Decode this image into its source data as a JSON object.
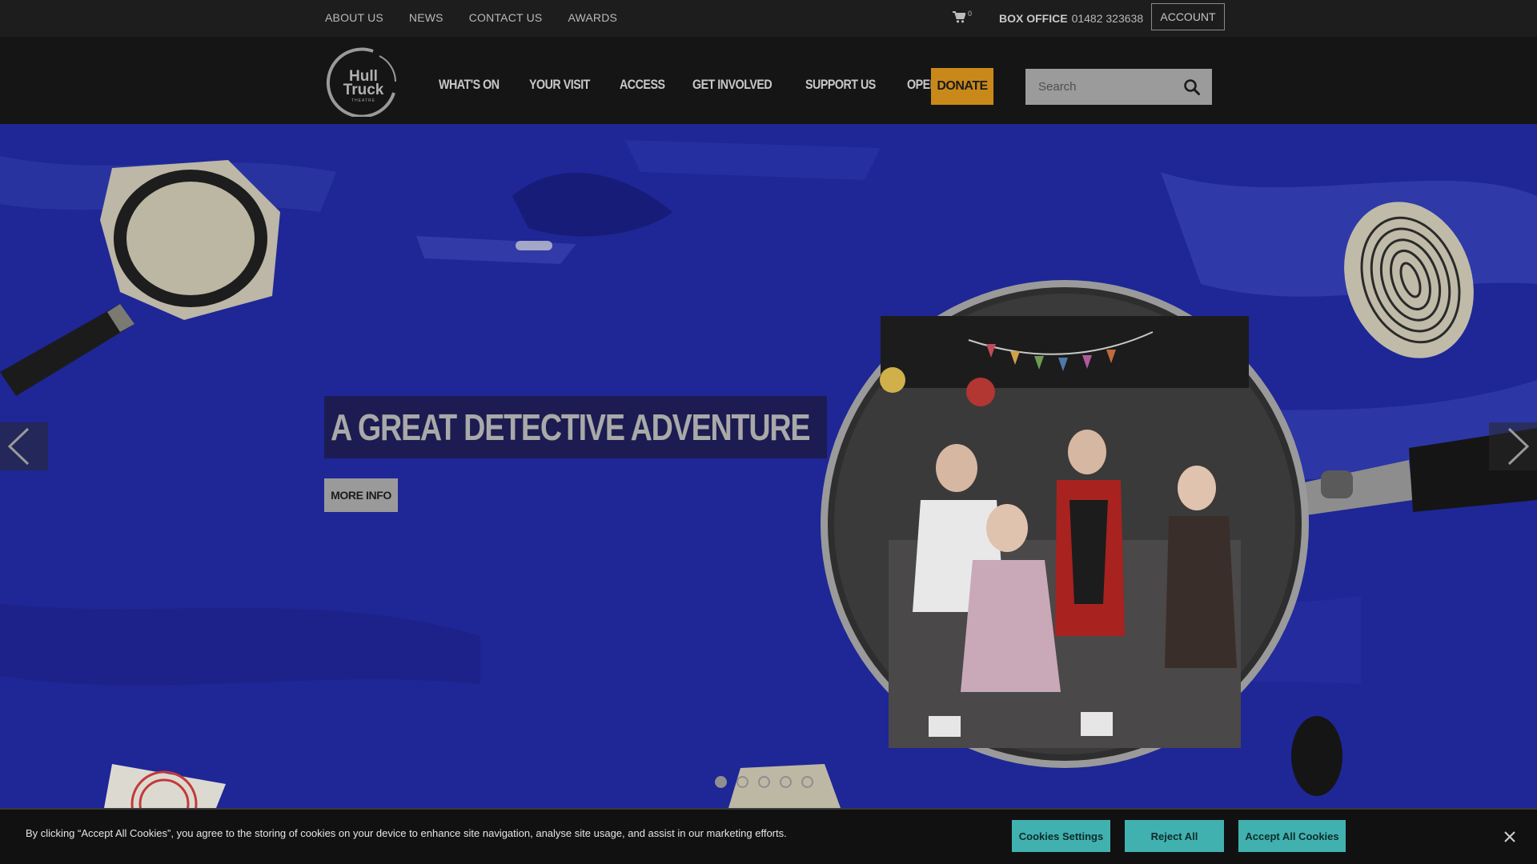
{
  "utility_nav": {
    "items": [
      {
        "label": "ABOUT US"
      },
      {
        "label": "NEWS"
      },
      {
        "label": "CONTACT US"
      },
      {
        "label": "AWARDS"
      }
    ],
    "cart": {
      "icon": "cart-icon",
      "count": "0"
    },
    "box_office": {
      "label": "BOX OFFICE",
      "phone": "01482 323638"
    },
    "account_label": "ACCOUNT"
  },
  "header": {
    "logo_text": {
      "line1": "Hull",
      "line2": "Truck",
      "line3": "THEATRE"
    },
    "nav": [
      {
        "label": "WHAT'S ON"
      },
      {
        "label": "YOUR VISIT"
      },
      {
        "label": "ACCESS"
      },
      {
        "label": "GET INVOLVED"
      },
      {
        "label": "SUPPORT US"
      },
      {
        "label": "OPEN DAY"
      }
    ],
    "donate_label": "DONATE",
    "search": {
      "placeholder": "Search",
      "icon": "search-icon"
    }
  },
  "hero": {
    "title": "A GREAT DETECTIVE ADVENTURE",
    "cta_label": "MORE INFO",
    "slides_total": 5,
    "active_slide": 1,
    "colors": {
      "background": "#1f2696",
      "title_box": "#1c1c52"
    }
  },
  "cookie_banner": {
    "text": "By clicking “Accept All Cookies”, you agree to the storing of cookies on your device to enhance site navigation, analyse site usage, and assist in our marketing efforts.",
    "settings_label": "Cookies Settings",
    "reject_label": "Reject All",
    "accept_label": "Accept All Cookies",
    "accent_color": "#41b1b0"
  },
  "colors": {
    "donate": "#c9891a"
  }
}
